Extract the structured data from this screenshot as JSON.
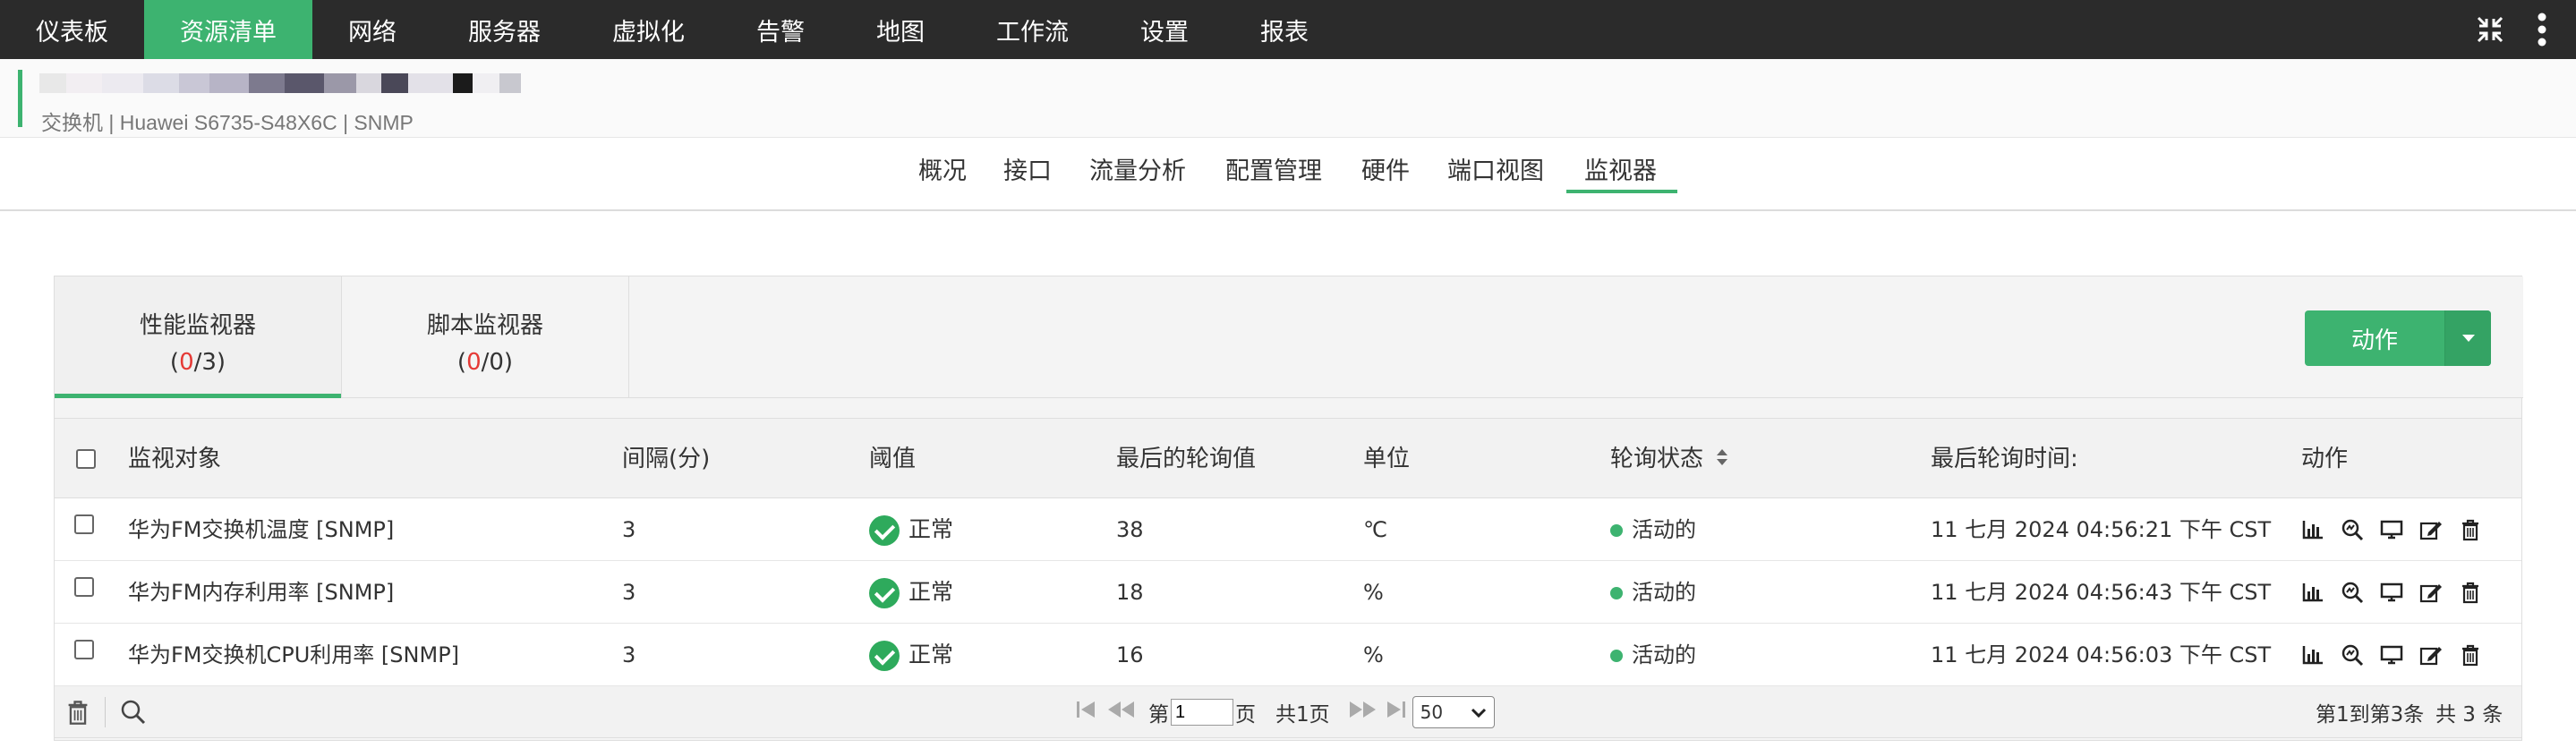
{
  "topnav": {
    "items": [
      {
        "label": "仪表板"
      },
      {
        "label": "资源清单"
      },
      {
        "label": "网络"
      },
      {
        "label": "服务器"
      },
      {
        "label": "虚拟化"
      },
      {
        "label": "告警"
      },
      {
        "label": "地图"
      },
      {
        "label": "工作流"
      },
      {
        "label": "设置"
      },
      {
        "label": "报表"
      }
    ],
    "active_index": 1,
    "accent_color": "#3db370"
  },
  "device": {
    "subtitle": "交换机 | Huawei S6735-S48X6C  | SNMP"
  },
  "subtabs": {
    "items": [
      {
        "label": "概况"
      },
      {
        "label": "接口"
      },
      {
        "label": "流量分析"
      },
      {
        "label": "配置管理"
      },
      {
        "label": "硬件"
      },
      {
        "label": "端口视图"
      },
      {
        "label": "监视器"
      }
    ],
    "active": "监视器"
  },
  "monitor_tabs": {
    "performance": {
      "label": "性能监视器",
      "count_open": "(",
      "count_a": "0",
      "count_sep": "/",
      "count_b": "3",
      "count_close": ")"
    },
    "script": {
      "label": "脚本监视器",
      "count_open": "(",
      "count_a": "0",
      "count_sep": "/",
      "count_b": "0",
      "count_close": ")"
    }
  },
  "action_button": {
    "label": "动作"
  },
  "table": {
    "headers": {
      "object": "监视对象",
      "interval": "间隔(分)",
      "threshold": "阈值",
      "last_value": "最后的轮询值",
      "unit": "单位",
      "poll_status": "轮询状态",
      "last_poll_time": "最后轮询时间:",
      "actions": "动作"
    },
    "rows": [
      {
        "object": "华为FM交换机温度 [SNMP]",
        "interval": "3",
        "threshold": "正常",
        "last_value": "38",
        "unit": "℃",
        "poll_status": "活动的",
        "last_poll_time": "11 七月 2024 04:56:21 下午 CST"
      },
      {
        "object": "华为FM内存利用率 [SNMP]",
        "interval": "3",
        "threshold": "正常",
        "last_value": "18",
        "unit": "%",
        "poll_status": "活动的",
        "last_poll_time": "11 七月 2024 04:56:43 下午 CST"
      },
      {
        "object": "华为FM交换机CPU利用率 [SNMP]",
        "interval": "3",
        "threshold": "正常",
        "last_value": "16",
        "unit": "%",
        "poll_status": "活动的",
        "last_poll_time": "11 七月 2024 04:56:03 下午 CST"
      }
    ]
  },
  "pagination": {
    "page_prefix": "第",
    "page_value": "1",
    "page_suffix": "页",
    "total_pages": "共1页",
    "page_size": "50",
    "range": "第1到第3条",
    "total": "共 3 条"
  }
}
